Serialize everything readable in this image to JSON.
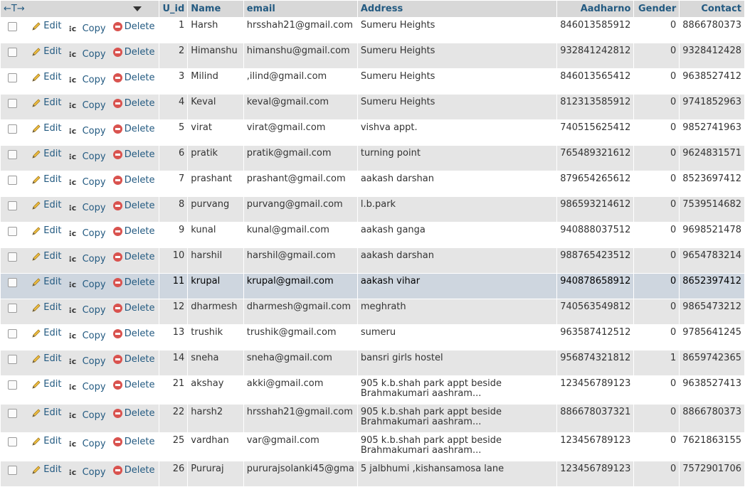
{
  "header": {
    "nav_arrows": "←T→",
    "columns": [
      "U_id",
      "Name",
      "email",
      "Address",
      "Aadharno",
      "Gender",
      "Contact"
    ]
  },
  "actions": {
    "edit": "Edit",
    "copy": "Copy",
    "delete": "Delete"
  },
  "rows": [
    {
      "uid": "1",
      "name": "Harsh",
      "email": "hrsshah21@gmail.com",
      "address": "Sumeru Heights",
      "aadhar": "846013585912",
      "gender": "0",
      "contact": "8866780373"
    },
    {
      "uid": "2",
      "name": "Himanshu",
      "email": "himanshu@gmail.com",
      "address": "Sumeru Heights",
      "aadhar": "932841242812",
      "gender": "0",
      "contact": "9328412428"
    },
    {
      "uid": "3",
      "name": "Milind",
      "email": ",ilind@gmail.com",
      "address": "Sumeru Heights",
      "aadhar": "846013565412",
      "gender": "0",
      "contact": "9638527412"
    },
    {
      "uid": "4",
      "name": "Keval",
      "email": "keval@gmail.com",
      "address": "Sumeru Heights",
      "aadhar": "812313585912",
      "gender": "0",
      "contact": "9741852963"
    },
    {
      "uid": "5",
      "name": "virat",
      "email": "virat@gmail.com",
      "address": "vishva appt.",
      "aadhar": "740515625412",
      "gender": "0",
      "contact": "9852741963"
    },
    {
      "uid": "6",
      "name": "pratik",
      "email": "pratik@gmail.com",
      "address": "turning point",
      "aadhar": "765489321612",
      "gender": "0",
      "contact": "9624831571"
    },
    {
      "uid": "7",
      "name": "prashant",
      "email": "prashant@gmail.com",
      "address": "aakash darshan",
      "aadhar": "879654265612",
      "gender": "0",
      "contact": "8523697412"
    },
    {
      "uid": "8",
      "name": "purvang",
      "email": "purvang@gmail.com",
      "address": "l.b.park",
      "aadhar": "986593214612",
      "gender": "0",
      "contact": "7539514682"
    },
    {
      "uid": "9",
      "name": "kunal",
      "email": "kunal@gmail.com",
      "address": "aakash ganga",
      "aadhar": "940888037512",
      "gender": "0",
      "contact": "9698521478"
    },
    {
      "uid": "10",
      "name": "harshil",
      "email": "harshil@gmail.com",
      "address": "aakash darshan",
      "aadhar": "988765423512",
      "gender": "0",
      "contact": "9654783214"
    },
    {
      "uid": "11",
      "name": "krupal",
      "email": "krupal@gmail.com",
      "address": "aakash vihar",
      "aadhar": "940878658912",
      "gender": "0",
      "contact": "8652397412"
    },
    {
      "uid": "12",
      "name": "dharmesh",
      "email": "dharmesh@gmail.com",
      "address": "meghrath",
      "aadhar": "740563549812",
      "gender": "0",
      "contact": "9865473212"
    },
    {
      "uid": "13",
      "name": "trushik",
      "email": "trushik@gmail.com",
      "address": "sumeru",
      "aadhar": "963587412512",
      "gender": "0",
      "contact": "9785641245"
    },
    {
      "uid": "14",
      "name": "sneha",
      "email": "sneha@gmail.com",
      "address": "bansri girls hostel",
      "aadhar": "956874321812",
      "gender": "1",
      "contact": "8659742365"
    },
    {
      "uid": "21",
      "name": "akshay",
      "email": "akki@gmail.com",
      "address": "905 k.b.shah park appt beside Brahmakumari aashram...",
      "aadhar": "123456789123",
      "gender": "0",
      "contact": "9638527413"
    },
    {
      "uid": "22",
      "name": "harsh2",
      "email": "hrsshah21@gmail.com",
      "address": "905 k.b.shah park appt beside Brahmakumari aashram...",
      "aadhar": "886678037321",
      "gender": "0",
      "contact": "8866780373"
    },
    {
      "uid": "25",
      "name": "vardhan",
      "email": "var@gmail.com",
      "address": "905 k.b.shah park appt beside Brahmakumari aashram...",
      "aadhar": "123456789123",
      "gender": "0",
      "contact": "7621863155"
    },
    {
      "uid": "26",
      "name": "Pururaj",
      "email": "pururajsolanki45@gma",
      "address": "5 jalbhumi ,kishansamosa lane",
      "aadhar": "123456789123",
      "gender": "0",
      "contact": "7572901706"
    }
  ],
  "highlight_row_uid": "11"
}
